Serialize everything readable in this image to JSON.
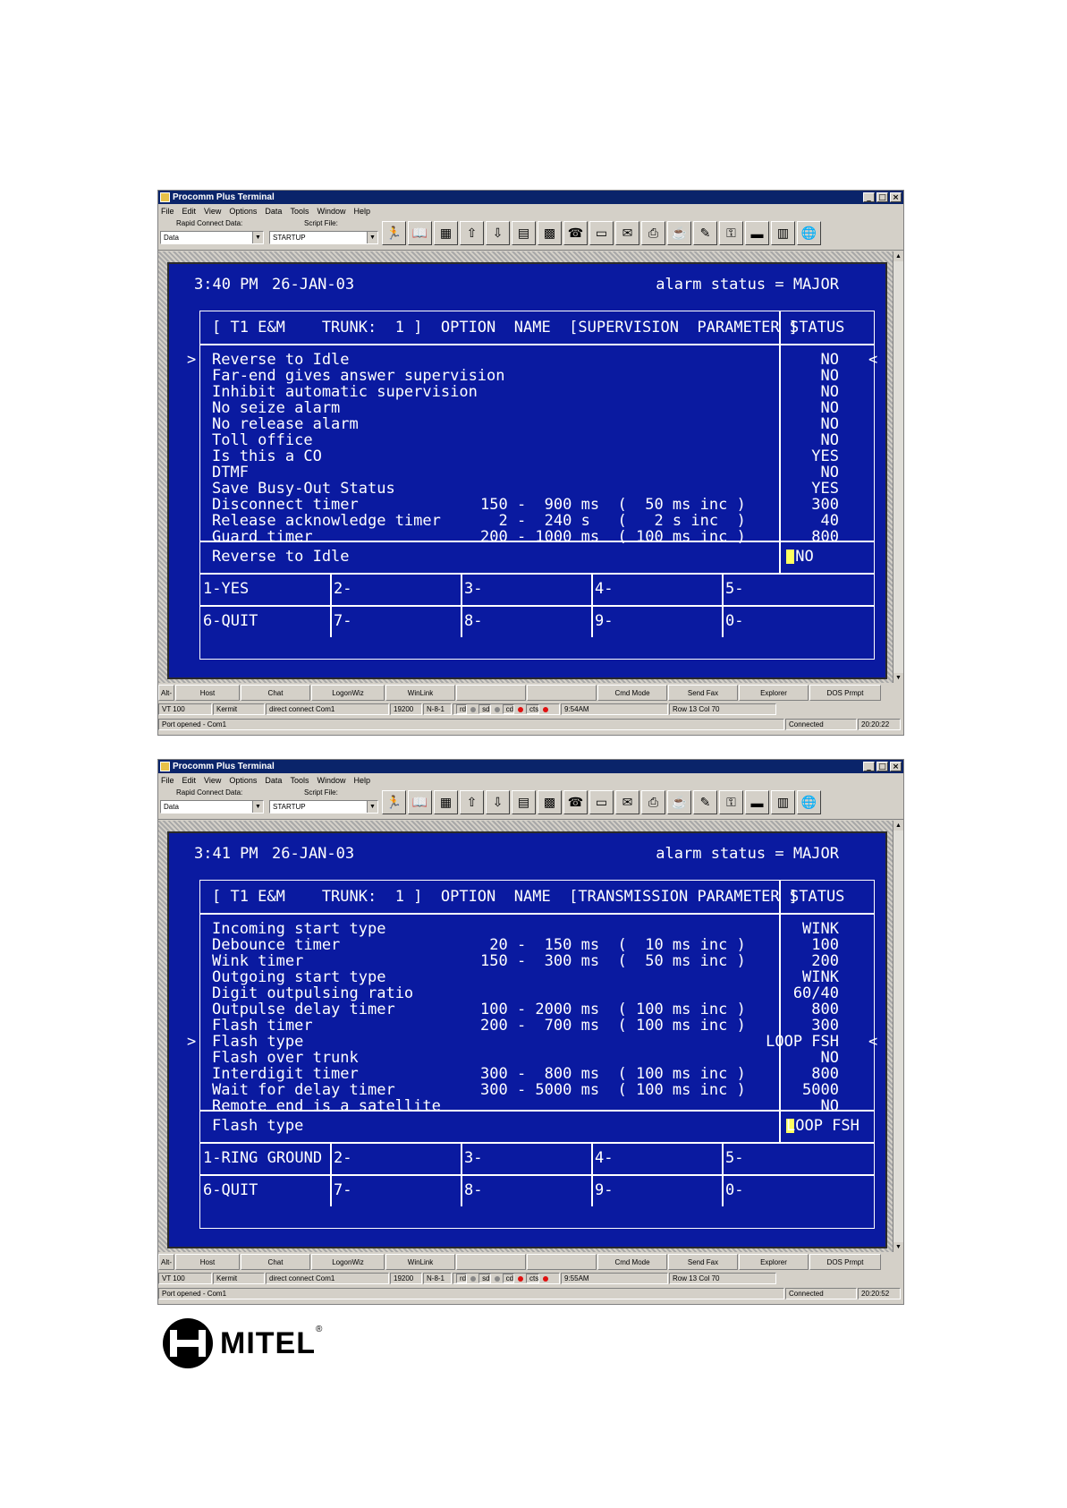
{
  "windows": [
    {
      "app_title": "Procomm Plus Terminal",
      "menu": [
        "File",
        "Edit",
        "View",
        "Options",
        "Data",
        "Tools",
        "Window",
        "Help"
      ],
      "toolbar": {
        "rapid_connect_label": "Rapid Connect Data:",
        "rapid_connect_value": "Data",
        "script_label": "Script File:",
        "script_value": "STARTUP",
        "icons": [
          "run-icon",
          "book-icon",
          "mode-icon",
          "upload-icon",
          "download-icon",
          "chart-icon",
          "grid-icon",
          "phone-icon",
          "monitor-icon",
          "fax-icon",
          "print-icon",
          "cup-icon",
          "edit-icon",
          "key-icon",
          "card-icon",
          "meter-icon",
          "globe-icon"
        ]
      },
      "terminal": {
        "time": "3:40 PM",
        "date": "26-JAN-03",
        "alarm_status": "alarm status = MAJOR",
        "header": "[ T1 E&M    TRUNK:  1 ]  OPTION  NAME  [SUPERVISION  PARAMETER ]",
        "status_header": "STATUS",
        "selected_index": 0,
        "rows": [
          {
            "name": "Reverse to Idle",
            "range": "",
            "status": "NO"
          },
          {
            "name": "Far-end gives answer supervision",
            "range": "",
            "status": "NO"
          },
          {
            "name": "Inhibit automatic supervision",
            "range": "",
            "status": "NO"
          },
          {
            "name": "No seize alarm",
            "range": "",
            "status": "NO"
          },
          {
            "name": "No release alarm",
            "range": "",
            "status": "NO"
          },
          {
            "name": "Toll office",
            "range": "",
            "status": "NO"
          },
          {
            "name": "Is this a CO",
            "range": "",
            "status": "YES"
          },
          {
            "name": "DTMF",
            "range": "",
            "status": "NO"
          },
          {
            "name": "Save Busy-Out Status",
            "range": "",
            "status": "YES"
          },
          {
            "name": "Disconnect timer",
            "range": "150 -  900 ms  (  50 ms inc )",
            "status": "300"
          },
          {
            "name": "Release acknowledge timer",
            "range": "  2 -  240 s   (   2 s inc  )",
            "status": "40"
          },
          {
            "name": "Guard timer",
            "range": "200 - 1000 ms  ( 100 ms inc )",
            "status": "800"
          }
        ],
        "current_name": "Reverse to Idle",
        "current_value": " NO",
        "softkeys_row1": [
          "1-YES",
          "2-",
          "3-",
          "4-",
          "5-"
        ],
        "softkeys_row2": [
          "6-QUIT",
          "7-",
          "8-",
          "9-",
          "0-"
        ]
      },
      "hotkeys": [
        "Alt-",
        "Host",
        "Chat",
        "LogonWiz",
        "WinLink",
        "",
        "",
        "Cmd Mode",
        "Send Fax",
        "Explorer",
        "DOS Prmpt"
      ],
      "status1": {
        "term": "VT 100",
        "proto": "Kermit",
        "conn": "direct connect Com1",
        "baud": "19200",
        "parity": "N-8-1",
        "rd": "rd",
        "sd": "sd",
        "cd": "cd",
        "cts": "cts",
        "time": "9:54AM",
        "rowcol": "Row 13   Col 70"
      },
      "status2": {
        "msg": "Port opened - Com1",
        "state": "Connected",
        "clock": "20:20:22"
      }
    },
    {
      "app_title": "Procomm Plus Terminal",
      "menu": [
        "File",
        "Edit",
        "View",
        "Options",
        "Data",
        "Tools",
        "Window",
        "Help"
      ],
      "toolbar": {
        "rapid_connect_label": "Rapid Connect Data:",
        "rapid_connect_value": "Data",
        "script_label": "Script File:",
        "script_value": "STARTUP",
        "icons": [
          "run-icon",
          "book-icon",
          "mode-icon",
          "upload-icon",
          "download-icon",
          "chart-icon",
          "grid-icon",
          "phone-icon",
          "monitor-icon",
          "fax-icon",
          "print-icon",
          "cup-icon",
          "edit-icon",
          "key-icon",
          "card-icon",
          "meter-icon",
          "globe-icon"
        ]
      },
      "terminal": {
        "time": "3:41 PM",
        "date": "26-JAN-03",
        "alarm_status": "alarm status = MAJOR",
        "header": "[ T1 E&M    TRUNK:  1 ]  OPTION  NAME  [TRANSMISSION PARAMETER ]",
        "status_header": "STATUS",
        "selected_index": 7,
        "rows": [
          {
            "name": "Incoming start type",
            "range": "",
            "status": "WINK"
          },
          {
            "name": "Debounce timer",
            "range": " 20 -  150 ms  (  10 ms inc )",
            "status": "100"
          },
          {
            "name": "Wink timer",
            "range": "150 -  300 ms  (  50 ms inc )",
            "status": "200"
          },
          {
            "name": "Outgoing start type",
            "range": "",
            "status": "WINK"
          },
          {
            "name": "Digit outpulsing ratio",
            "range": "",
            "status": "60/40"
          },
          {
            "name": "Outpulse delay timer",
            "range": "100 - 2000 ms  ( 100 ms inc )",
            "status": "800"
          },
          {
            "name": "Flash timer",
            "range": "200 -  700 ms  ( 100 ms inc )",
            "status": "300"
          },
          {
            "name": "Flash type",
            "range": "",
            "status": "LOOP FSH"
          },
          {
            "name": "Flash over trunk",
            "range": "",
            "status": "NO"
          },
          {
            "name": "Interdigit timer",
            "range": "300 -  800 ms  ( 100 ms inc )",
            "status": "800"
          },
          {
            "name": "Wait for delay timer",
            "range": "300 - 5000 ms  ( 100 ms inc )",
            "status": "5000"
          },
          {
            "name": "Remote end is a satellite",
            "range": "",
            "status": "NO"
          }
        ],
        "current_name": "Flash type",
        "current_value": "LOOP FSH",
        "softkeys_row1": [
          "1-RING GROUND",
          "2-",
          "3-",
          "4-",
          "5-"
        ],
        "softkeys_row2": [
          "6-QUIT",
          "7-",
          "8-",
          "9-",
          "0-"
        ]
      },
      "hotkeys": [
        "Alt-",
        "Host",
        "Chat",
        "LogonWiz",
        "WinLink",
        "",
        "",
        "Cmd Mode",
        "Send Fax",
        "Explorer",
        "DOS Prmpt"
      ],
      "status1": {
        "term": "VT 100",
        "proto": "Kermit",
        "conn": "direct connect Com1",
        "baud": "19200",
        "parity": "N-8-1",
        "rd": "rd",
        "sd": "sd",
        "cd": "cd",
        "cts": "cts",
        "time": "9:55AM",
        "rowcol": "Row 13   Col 70"
      },
      "status2": {
        "msg": "Port opened - Com1",
        "state": "Connected",
        "clock": "20:20:52"
      }
    }
  ],
  "logo": {
    "text": "MITEL"
  }
}
